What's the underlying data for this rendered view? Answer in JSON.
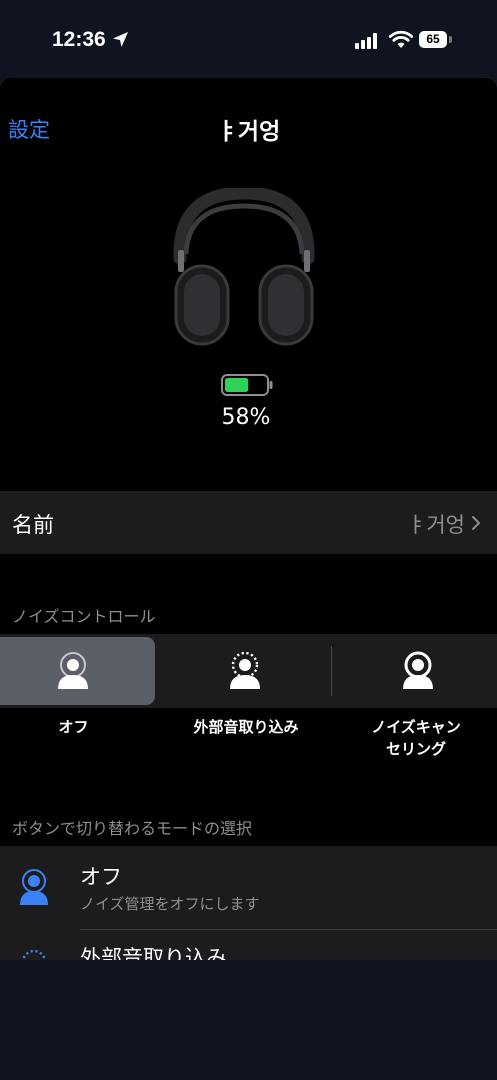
{
  "status_bar": {
    "time": "12:36",
    "battery": "65"
  },
  "nav": {
    "back_label": "設定",
    "title": "ㅑ거엉"
  },
  "device": {
    "battery_level": 0.58,
    "battery_text": "58%",
    "battery_color": "#30d158"
  },
  "name_row": {
    "label": "名前",
    "value": "ㅑ거엉"
  },
  "noise_control": {
    "header": "ノイズコントロール",
    "selected_index": 0,
    "options": [
      {
        "label": "オフ",
        "icon": "person-off-icon"
      },
      {
        "label": "外部音取り込み",
        "icon": "transparency-icon"
      },
      {
        "label": "ノイズキャン\nセリング",
        "icon": "noise-cancel-icon"
      }
    ]
  },
  "button_modes": {
    "header": "ボタンで切り替わるモードの選択",
    "items": [
      {
        "title": "オフ",
        "subtitle": "ノイズ管理をオフにします",
        "icon": "person-off-icon"
      },
      {
        "title": "外部音取り込み",
        "subtitle": "",
        "icon": "transparency-icon"
      }
    ]
  },
  "colors": {
    "accent": "#3a82f7",
    "background": "#000000",
    "cell": "#1c1c1e",
    "selected_segment": "#5b5f68"
  }
}
